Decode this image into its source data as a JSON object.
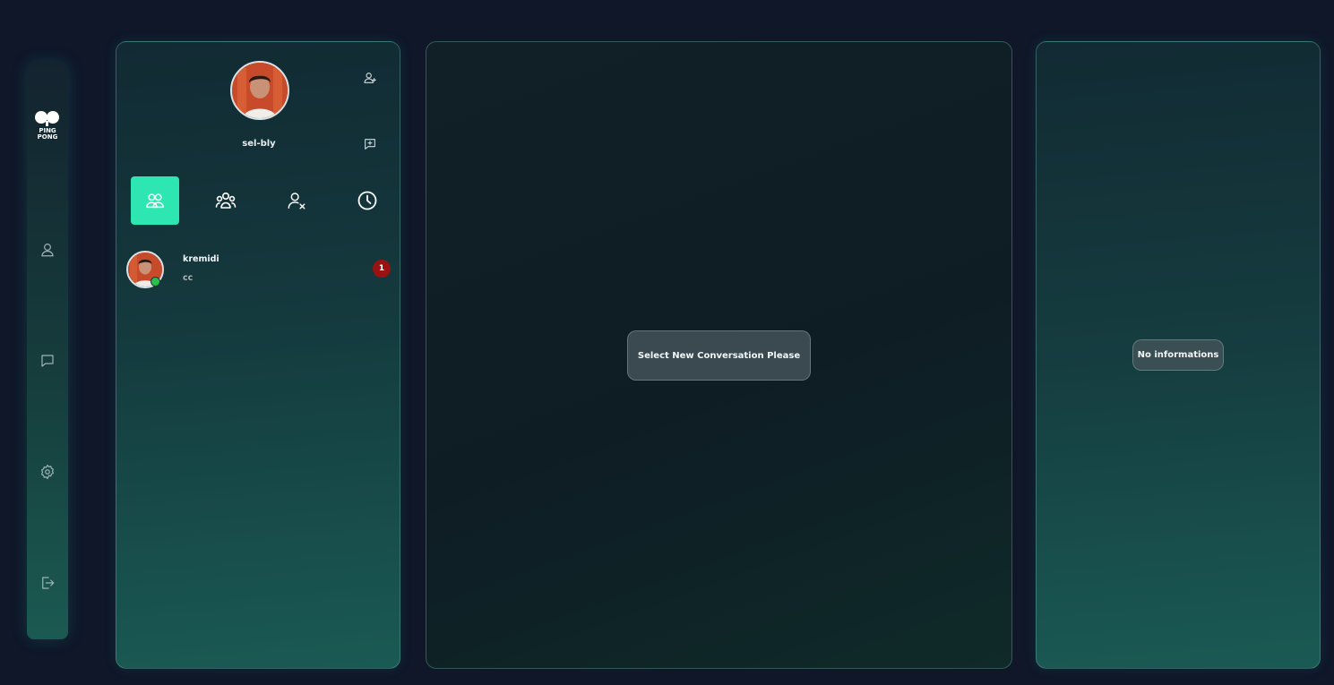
{
  "sidebar": {
    "logo_text": [
      "PING",
      "PONG"
    ],
    "items": [
      {
        "icon": "user-icon"
      },
      {
        "icon": "chat-icon"
      },
      {
        "icon": "settings-icon"
      },
      {
        "icon": "logout-icon"
      }
    ]
  },
  "chat_list": {
    "username": "sel-bly",
    "tabs": [
      {
        "icon": "friends-icon",
        "active": true
      },
      {
        "icon": "groups-icon",
        "active": false
      },
      {
        "icon": "blocked-user-icon",
        "active": false
      },
      {
        "icon": "history-icon",
        "active": false
      }
    ],
    "conversations": [
      {
        "name": "kremidi",
        "last_message": "cc",
        "unread": "1",
        "online": true
      }
    ]
  },
  "conversation": {
    "empty_message": "Select New Conversation Please"
  },
  "info": {
    "empty_message": "No informations"
  },
  "colors": {
    "accent": "#2ee6b1",
    "badge": "#9a1212",
    "online": "#2bbf4a",
    "background": "#0f1729"
  }
}
